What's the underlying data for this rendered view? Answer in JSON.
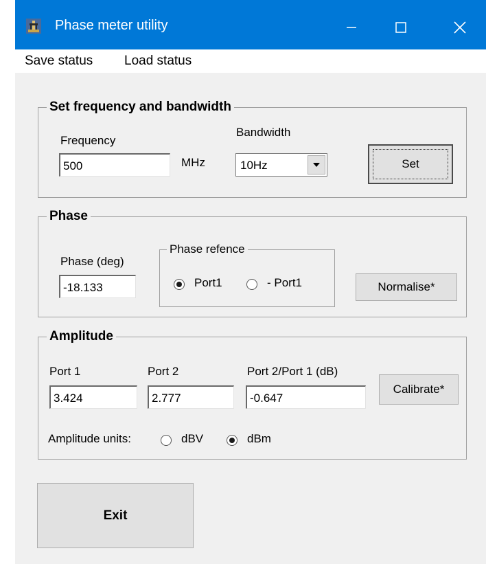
{
  "window": {
    "title": "Phase meter utility",
    "titlebar_color": "#0078d7",
    "controls": {
      "minimize": "minimize-icon",
      "maximize": "maximize-icon",
      "close": "close-icon"
    }
  },
  "menu": {
    "items": [
      "Save status",
      "Load status"
    ]
  },
  "freq_group": {
    "title": "Set frequency and bandwidth",
    "frequency_label": "Frequency",
    "frequency_value": "500",
    "unit": "MHz",
    "bandwidth_label": "Bandwidth",
    "bandwidth_value": "10Hz",
    "set_button": "Set"
  },
  "phase_group": {
    "title": "Phase",
    "phase_label": "Phase (deg)",
    "phase_value": "-18.133",
    "reference": {
      "title": "Phase refence",
      "options": [
        "Port1",
        "- Port1"
      ],
      "selected": "Port1"
    },
    "normalise_button": "Normalise*"
  },
  "amplitude_group": {
    "title": "Amplitude",
    "port1_label": "Port 1",
    "port1_value": "3.424",
    "port2_label": "Port 2",
    "port2_value": "2.777",
    "ratio_label": "Port 2/Port 1 (dB)",
    "ratio_value": "-0.647",
    "calibrate_button": "Calibrate*",
    "units_label": "Amplitude units:",
    "units_options": [
      "dBV",
      "dBm"
    ],
    "units_selected": "dBm"
  },
  "exit_button": "Exit"
}
